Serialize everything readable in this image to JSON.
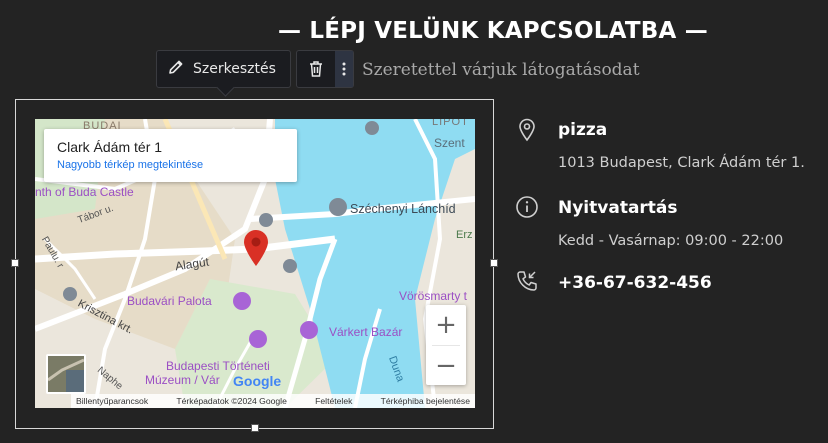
{
  "section": {
    "heading": "— LÉPJ VELÜNK KAPCSOLATBA —",
    "subheading": "Szeretettel várjuk látogatásodat"
  },
  "editor_toolbar": {
    "edit_label": "Szerkesztés",
    "icons": [
      "pencil-icon",
      "trash-icon",
      "more-vertical-icon"
    ]
  },
  "map": {
    "info_title": "Clark Ádám tér 1",
    "info_link": "Nagyobb térkép megtekintése",
    "labels": {
      "budai": "BUDAI",
      "lipot": "LIPÓT",
      "szent": "Szent",
      "buda_castle": "nth of Buda Castle",
      "tabor": "Tábor u.",
      "szechenyi": "Széchenyi Lánchíd",
      "erz": "Erz",
      "alagut": "Alagút",
      "paulu": "Paulu. r",
      "budavari": "Budavári Palota",
      "vorosmarty": "Vörösmarty t",
      "krisztina": "Krisztina krt.",
      "varkert": "Várkert Bazár",
      "tortenet1": "Budapesti Történeti",
      "tortenet2": "Múzeum / Vár",
      "duna": "Duna",
      "naphe": "Naphe",
      "google": "Google"
    },
    "zoom_in": "+",
    "zoom_out": "−",
    "footer": {
      "shortcuts": "Billentyűparancsok",
      "mapdata": "Térképadatok ©2024 Google",
      "terms": "Feltételek",
      "report": "Térképhiba bejelentése"
    },
    "colors": {
      "water": "#8fdcf2",
      "land": "#ebe6dc",
      "park": "#cfe8c5",
      "road": "#ffffff",
      "pin": "#d93025",
      "poi": "#a864d6",
      "link": "#1a73e8"
    }
  },
  "contact": {
    "name": "pizza",
    "address": "1013 Budapest, Clark Ádám tér 1.",
    "hours_title": "Nyitvatartás",
    "hours": "Kedd - Vasárnap: 09:00 - 22:00",
    "phone": "+36-67-632-456",
    "icons": [
      "location-pin-icon",
      "info-circle-icon",
      "phone-icon"
    ]
  }
}
